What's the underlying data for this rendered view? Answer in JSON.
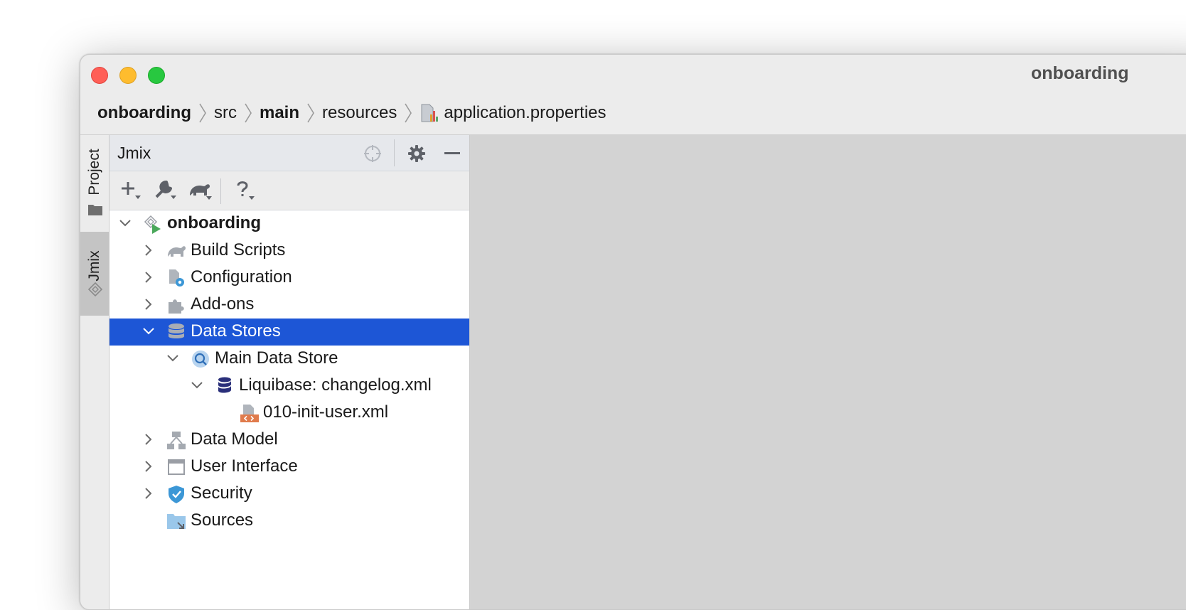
{
  "window": {
    "title": "onboarding"
  },
  "breadcrumb": {
    "items": [
      "onboarding",
      "src",
      "main",
      "resources"
    ],
    "file": "application.properties"
  },
  "sidebar": {
    "tabs": [
      {
        "label": "Project",
        "icon": "folder-icon"
      },
      {
        "label": "Jmix",
        "icon": "jmix-icon"
      }
    ]
  },
  "panel": {
    "title": "Jmix",
    "header_icons": [
      "locate-icon",
      "gear-icon",
      "minimize-icon"
    ],
    "toolbar": [
      "add-icon",
      "wrench-icon",
      "gradle-icon",
      "help-icon"
    ]
  },
  "tree": {
    "items": [
      {
        "label": "onboarding",
        "icon": "jmix-project-icon",
        "expanded": true
      },
      {
        "label": "Build Scripts",
        "icon": "gradle-icon",
        "expanded": false
      },
      {
        "label": "Configuration",
        "icon": "config-icon",
        "expanded": false
      },
      {
        "label": "Add-ons",
        "icon": "puzzle-icon",
        "expanded": false
      },
      {
        "label": "Data Stores",
        "icon": "database-icon",
        "expanded": true,
        "selected": true
      },
      {
        "label": "Main Data Store",
        "icon": "datastore-icon",
        "expanded": true
      },
      {
        "label": "Liquibase: changelog.xml",
        "icon": "liquibase-icon",
        "expanded": true
      },
      {
        "label": "010-init-user.xml",
        "icon": "xml-file-icon"
      },
      {
        "label": "Data Model",
        "icon": "hierarchy-icon",
        "expanded": false
      },
      {
        "label": "User Interface",
        "icon": "window-icon",
        "expanded": false
      },
      {
        "label": "Security",
        "icon": "shield-icon",
        "expanded": false
      },
      {
        "label": "Sources",
        "icon": "source-folder-icon"
      }
    ]
  },
  "colors": {
    "selection": "#1d56d6",
    "editor_bg": "#d3d3d3",
    "panel_header": "#e6e8ec"
  }
}
